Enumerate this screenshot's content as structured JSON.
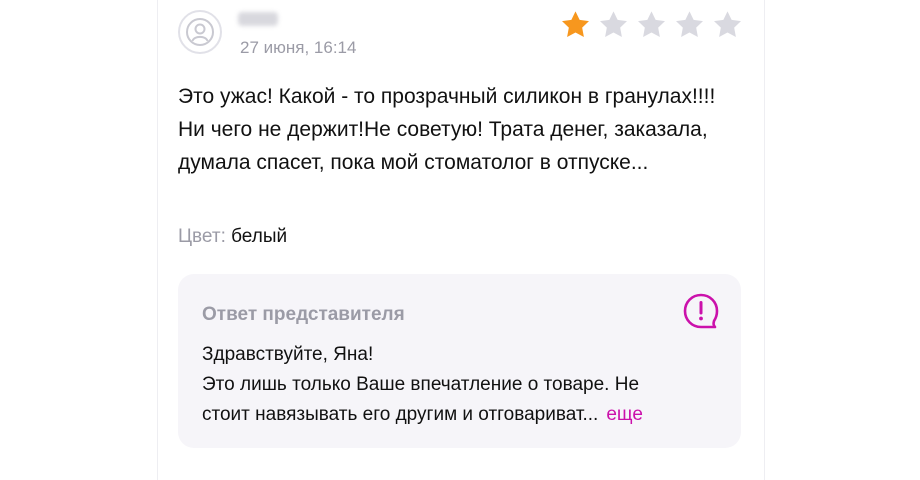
{
  "review": {
    "date": "27 июня, 16:14",
    "rating": 1,
    "rating_max": 5,
    "text": "Это ужас! Какой - то прозрачный силикон в гранулах!!!! Ни чего не держит!Не советую! Трата денег, заказала, думала спасет, пока мой стоматолог в отпуске...",
    "color_label": "Цвет:",
    "color_value": "белый"
  },
  "reply": {
    "title": "Ответ представителя",
    "line1": "Здравствуйте, Яна!",
    "line2": "Это лишь только Ваше впечатление о товаре. Не",
    "line3": "стоит навязывать его другим и отговариват...",
    "more_label": "еще"
  },
  "colors": {
    "star_filled": "#f7971e",
    "star_empty": "#d9d9e0",
    "accent": "#cb11ab",
    "muted_text": "#9b9ba6",
    "reply_background": "#f6f5f9"
  },
  "icons": {
    "avatar": "user-avatar-icon",
    "star": "star-icon",
    "reply": "exclamation-bubble-icon"
  }
}
